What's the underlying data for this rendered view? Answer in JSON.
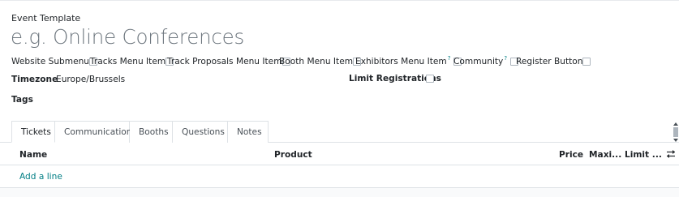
{
  "form": {
    "title_label": "Event Template",
    "name_placeholder": "e.g. Online Conferences"
  },
  "flags": [
    {
      "label": "Website Submenu",
      "has_help": false,
      "checked": false
    },
    {
      "label": "Tracks Menu Item",
      "has_help": false,
      "checked": false
    },
    {
      "label": "Track Proposals Menu Item",
      "has_help": false,
      "checked": false
    },
    {
      "label": "Booth Menu Item",
      "has_help": false,
      "checked": false
    },
    {
      "label": "Exhibitors Menu Item",
      "has_help": true,
      "help_mark": "?",
      "checked": false
    },
    {
      "label": "Community",
      "has_help": true,
      "help_mark": "?",
      "checked": false
    },
    {
      "label": "Register Button",
      "has_help": false,
      "checked": false
    }
  ],
  "fields": {
    "timezone_label": "Timezone",
    "timezone_value": "Europe/Brussels",
    "limit_label": "Limit Registrations",
    "limit_checked": false,
    "tags_label": "Tags"
  },
  "tabs": [
    {
      "label": "Tickets",
      "active": true
    },
    {
      "label": "Communication",
      "active": false
    },
    {
      "label": "Booths",
      "active": false
    },
    {
      "label": "Questions",
      "active": false
    },
    {
      "label": "Notes",
      "active": false
    }
  ],
  "table": {
    "columns": [
      "Name",
      "Product",
      "Price",
      "Maxi...",
      "Limit ..."
    ],
    "add_line_label": "Add a line",
    "optional_columns_icon": "sliders-icon"
  },
  "colors": {
    "link": "#017e84",
    "border": "#dee2e6",
    "placeholder": "#6c757d"
  }
}
